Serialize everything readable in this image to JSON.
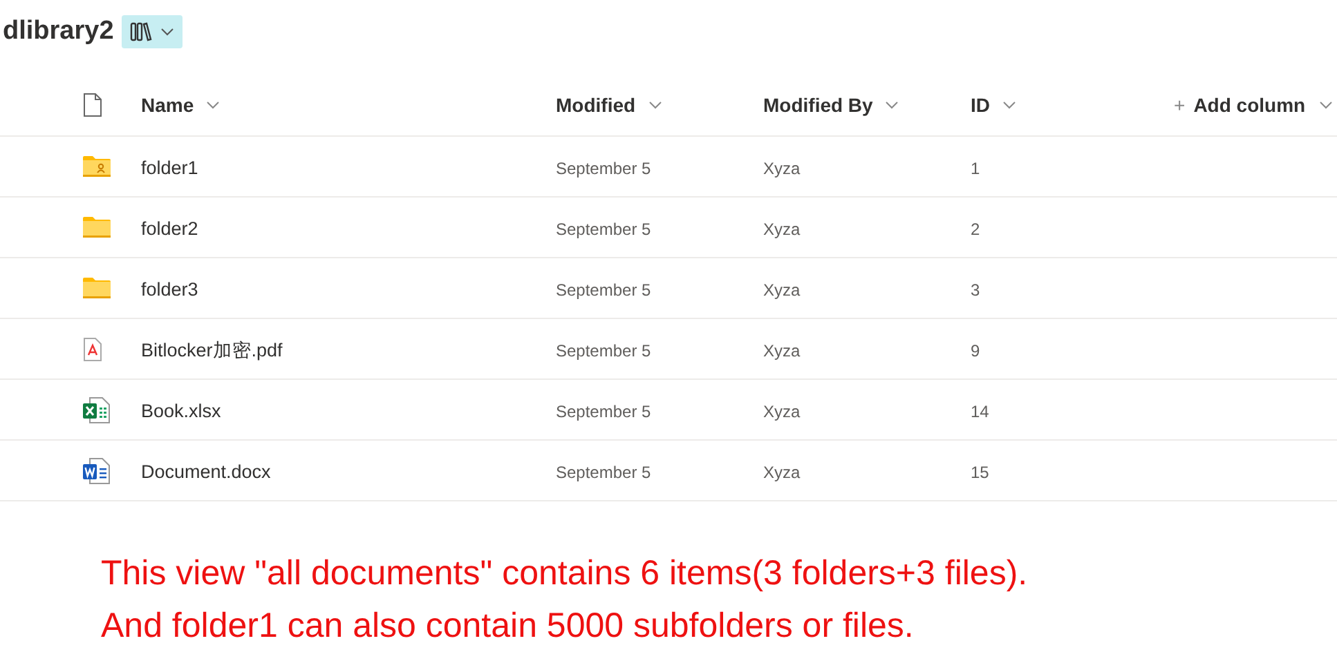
{
  "library": {
    "title": "dlibrary2"
  },
  "columns": [
    {
      "label": "Name"
    },
    {
      "label": "Modified"
    },
    {
      "label": "Modified By"
    },
    {
      "label": "ID"
    }
  ],
  "add_column": {
    "plus": "+",
    "label": "Add column"
  },
  "rows": [
    {
      "kind": "shared-folder",
      "name": "folder1",
      "modified": "September 5",
      "modified_by": "Xyza",
      "id": "1"
    },
    {
      "kind": "folder",
      "name": "folder2",
      "modified": "September 5",
      "modified_by": "Xyza",
      "id": "2"
    },
    {
      "kind": "folder",
      "name": "folder3",
      "modified": "September 5",
      "modified_by": "Xyza",
      "id": "3"
    },
    {
      "kind": "pdf",
      "name": "Bitlocker加密.pdf",
      "modified": "September 5",
      "modified_by": "Xyza",
      "id": "9"
    },
    {
      "kind": "excel",
      "name": "Book.xlsx",
      "modified": "September 5",
      "modified_by": "Xyza",
      "id": "14"
    },
    {
      "kind": "word",
      "name": "Document.docx",
      "modified": "September 5",
      "modified_by": "Xyza",
      "id": "15"
    }
  ],
  "annotation": [
    "This view \"all documents\" contains 6 items(3 folders+3 files).",
    "And folder1 can also contain 5000 subfolders or files."
  ]
}
